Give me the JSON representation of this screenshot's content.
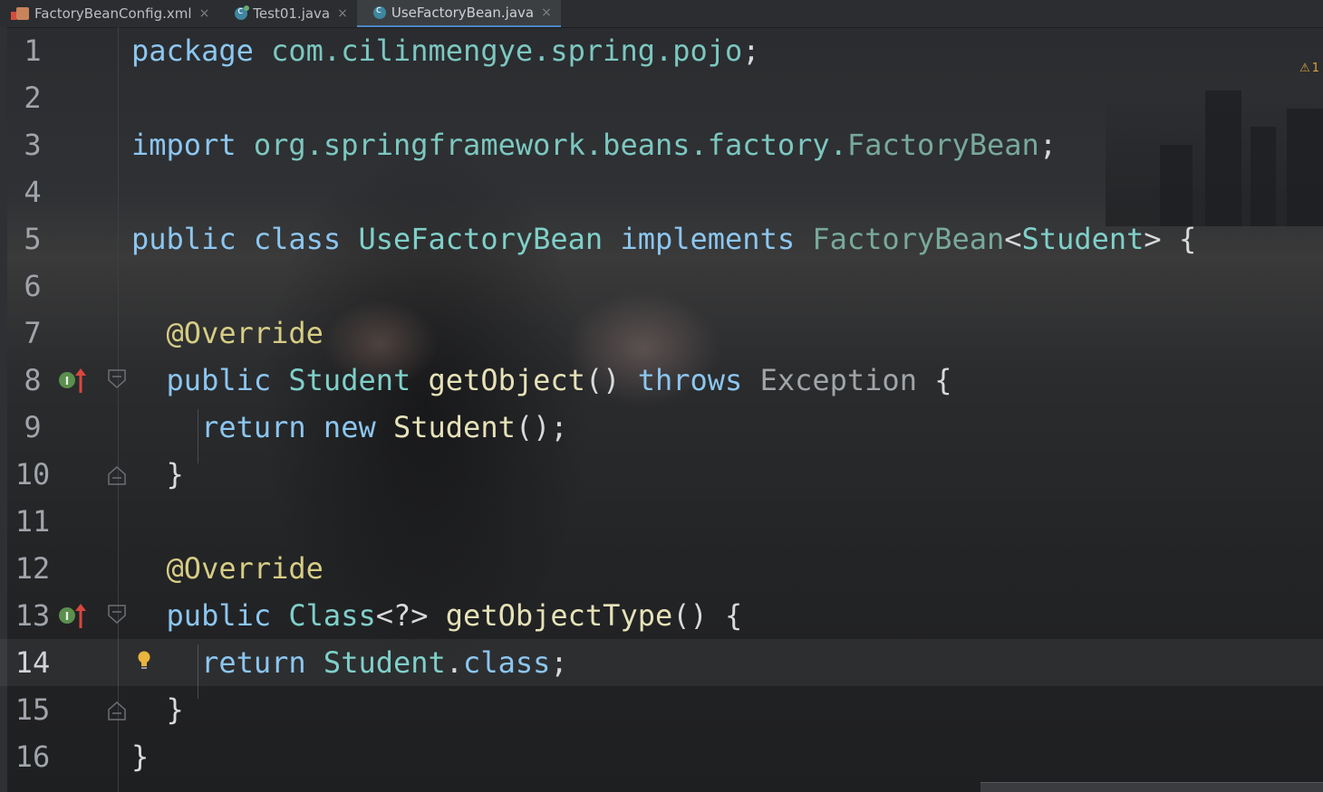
{
  "tabs": [
    {
      "label": "FactoryBeanConfig.xml",
      "icon": "xml-file-icon",
      "active": false
    },
    {
      "label": "Test01.java",
      "icon": "java-class-icon",
      "active": false
    },
    {
      "label": "UseFactoryBean.java",
      "icon": "java-class-icon",
      "active": true
    }
  ],
  "tab_close_glyph": "×",
  "warning_count": "1",
  "lines": [
    {
      "num": "1"
    },
    {
      "num": "2"
    },
    {
      "num": "3"
    },
    {
      "num": "4"
    },
    {
      "num": "5"
    },
    {
      "num": "6"
    },
    {
      "num": "7"
    },
    {
      "num": "8"
    },
    {
      "num": "9"
    },
    {
      "num": "10"
    },
    {
      "num": "11"
    },
    {
      "num": "12"
    },
    {
      "num": "13"
    },
    {
      "num": "14"
    },
    {
      "num": "15"
    },
    {
      "num": "16"
    }
  ],
  "code": {
    "l1": {
      "kw": "package",
      "pkg": "com.cilinmengye.spring.pojo",
      "end": ";"
    },
    "l3": {
      "kw": "import",
      "pkg": "org.springframework.beans.factory.",
      "cls": "FactoryBean",
      "end": ";"
    },
    "l5": {
      "kw1": "public",
      "kw2": "class",
      "name": "UseFactoryBean",
      "kw3": "implements",
      "iface": "FactoryBean",
      "lt": "<",
      "generic": "Student",
      "gt": ">",
      "brace": "{"
    },
    "l7": {
      "ann": "@Override"
    },
    "l8": {
      "kw": "public",
      "type": "Student",
      "fn": "getObject",
      "parens": "()",
      "kw2": "throws",
      "exc": "Exception",
      "brace": "{"
    },
    "l9": {
      "kw1": "return",
      "kw2": "new",
      "fn": "Student",
      "end": "();"
    },
    "l10": {
      "brace": "}"
    },
    "l12": {
      "ann": "@Override"
    },
    "l13": {
      "kw": "public",
      "type": "Class",
      "generic": "<?>",
      "fn": "getObjectType",
      "parens": "()",
      "brace": "{"
    },
    "l14": {
      "kw": "return",
      "type": "Student",
      "dot": ".",
      "kw2": "class",
      "end": ";"
    },
    "l15": {
      "brace": "}"
    },
    "l16": {
      "brace": "}"
    }
  },
  "current_line": "14"
}
